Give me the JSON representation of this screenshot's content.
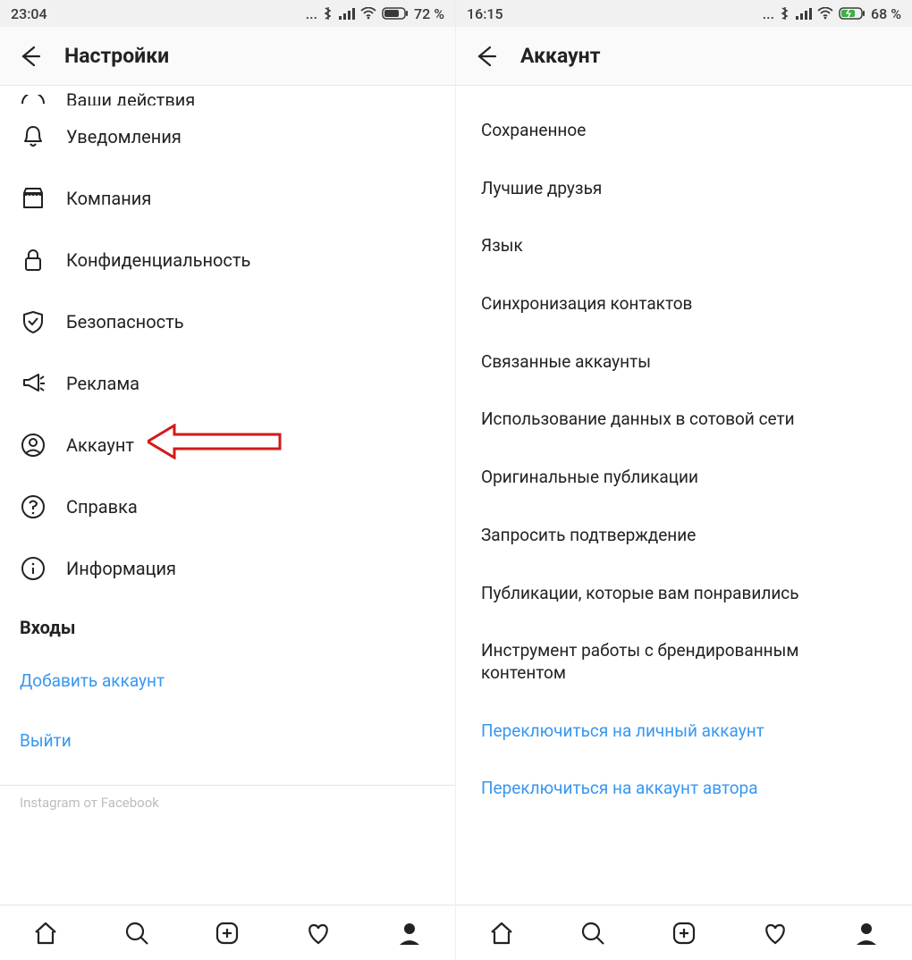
{
  "left": {
    "status": {
      "time": "23:04",
      "battery": "72 %"
    },
    "header": {
      "title": "Настройки"
    },
    "partial": {
      "label": "Ваши действия"
    },
    "items": [
      {
        "icon": "bell-icon",
        "label": "Уведомления"
      },
      {
        "icon": "store-icon",
        "label": "Компания"
      },
      {
        "icon": "lock-icon",
        "label": "Конфиденциальность"
      },
      {
        "icon": "shield-icon",
        "label": "Безопасность"
      },
      {
        "icon": "megaphone-icon",
        "label": "Реклама"
      },
      {
        "icon": "account-icon",
        "label": "Аккаунт"
      },
      {
        "icon": "help-icon",
        "label": "Справка"
      },
      {
        "icon": "info-icon",
        "label": "Информация"
      }
    ],
    "logins_header": "Входы",
    "links": [
      {
        "label": "Добавить аккаунт"
      },
      {
        "label": "Выйти"
      }
    ],
    "footer_note": "Instagram от Facebook",
    "arrow_target_index": 5
  },
  "right": {
    "status": {
      "time": "16:15",
      "battery": "68 %"
    },
    "header": {
      "title": "Аккаунт"
    },
    "items": [
      {
        "label": "Сохраненное"
      },
      {
        "label": "Лучшие друзья"
      },
      {
        "label": "Язык"
      },
      {
        "label": "Синхронизация контактов"
      },
      {
        "label": "Связанные аккаунты"
      },
      {
        "label": "Использование данных в сотовой сети"
      },
      {
        "label": "Оригинальные публикации"
      },
      {
        "label": "Запросить подтверждение"
      },
      {
        "label": "Публикации, которые вам понравились"
      },
      {
        "label": "Инструмент работы с брендированным контентом"
      }
    ],
    "blue_links": [
      {
        "label": "Переключиться на личный аккаунт"
      },
      {
        "label": "Переключиться на аккаунт автора"
      }
    ],
    "arrow_target_index": 4
  },
  "annotation_color": "#d21919"
}
